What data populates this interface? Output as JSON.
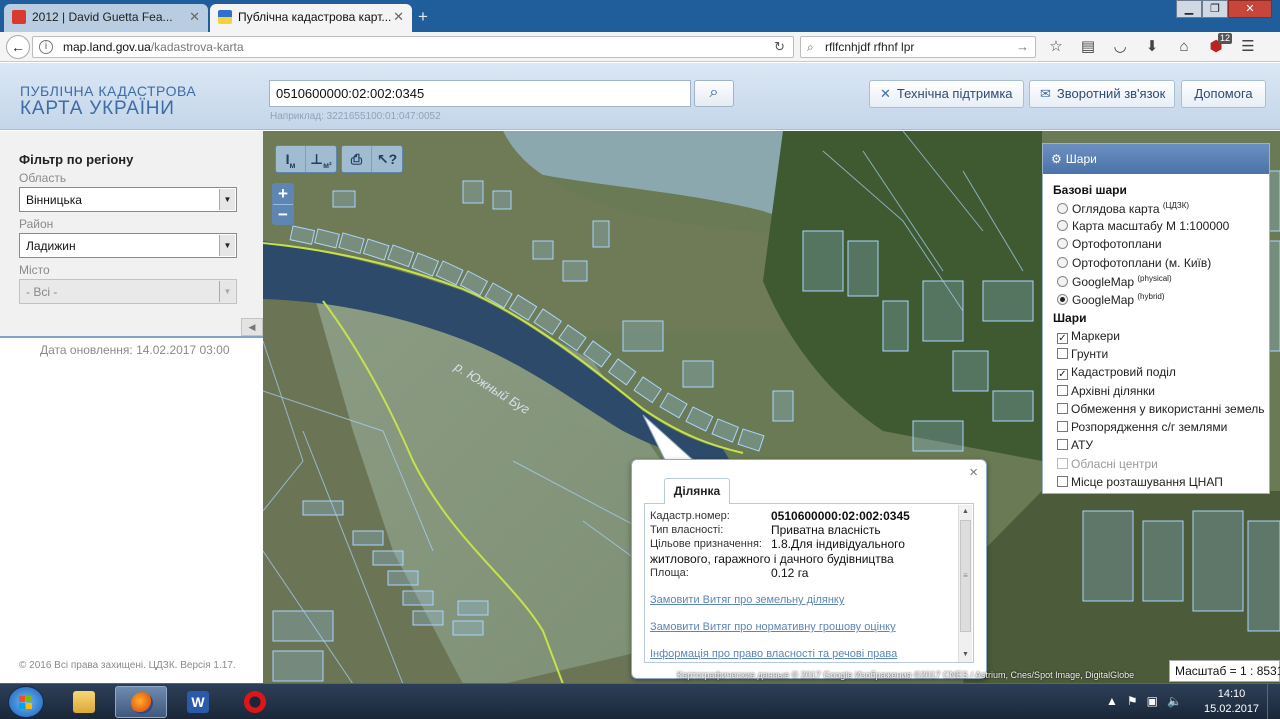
{
  "browser": {
    "tabs": [
      {
        "title": "2012 | David Guetta Fea...",
        "active": false
      },
      {
        "title": "Публічна кадастрова карт...",
        "active": true
      }
    ],
    "new_tab": "+",
    "url_host": "map.land.gov.ua",
    "url_path": "/kadastrova-karta",
    "search_value": "rflfcnhjdf rfhnf lpr",
    "addon_badge": "12"
  },
  "header": {
    "logo_line1": "ПУБЛІЧНА КАДАСТРОВА",
    "logo_line2": "КАРТА УКРАЇНИ",
    "search_value": "0510600000:02:002:0345",
    "example": "Наприклад: 3221655100:01:047:0052",
    "support": "Технічна підтримка",
    "feedback": "Зворотний зв'язок",
    "help": "Допомога"
  },
  "filter": {
    "title": "Фільтр по регіону",
    "oblast_label": "Область",
    "oblast_value": "Вінницька",
    "rayon_label": "Район",
    "rayon_value": "Ладижин",
    "city_label": "Місто",
    "city_value": "- Всі -",
    "update_date": "Дата оновлення: 14.02.2017 03:00",
    "copyright": "© 2016 Всі права захищені. ЦДЗК. Версія 1.17."
  },
  "map": {
    "tools": [
      "I м",
      "⊥ м²",
      "print",
      "?"
    ],
    "zoom_in": "+",
    "zoom_out": "−",
    "river_label": "р. Южный Буг",
    "attribution": "Картографические данные © 2017 Google Изображения ©2017 CNES / Astrium, Cnes/Spot Image, DigitalGlobe",
    "scale": "Масштаб = 1 : 8531"
  },
  "layers": {
    "title": "Шари",
    "base_title": "Базові шари",
    "base": [
      {
        "label": "Оглядова карта",
        "sup": "(ЦДЗК)",
        "selected": false
      },
      {
        "label": "Карта масштабу М 1:100000",
        "sup": "",
        "selected": false
      },
      {
        "label": "Ортофотоплани",
        "sup": "",
        "selected": false
      },
      {
        "label": "Ортофотоплани (м. Київ)",
        "sup": "",
        "selected": false
      },
      {
        "label": "GoogleMap",
        "sup": "(physical)",
        "selected": false
      },
      {
        "label": "GoogleMap",
        "sup": "(hybrid)",
        "selected": true
      }
    ],
    "overlay_title": "Шари",
    "overlays": [
      {
        "label": "Маркери",
        "checked": true
      },
      {
        "label": "Грунти",
        "checked": false
      },
      {
        "label": "Кадастровий поділ",
        "checked": true
      },
      {
        "label": "Архівні ділянки",
        "checked": false
      },
      {
        "label": "Обмеження у використанні земель",
        "checked": false
      },
      {
        "label": "Розпорядження с/г землями",
        "checked": false
      },
      {
        "label": "АТУ",
        "checked": false
      },
      {
        "label": "Обласні центри",
        "checked": false,
        "disabled": true
      },
      {
        "label": "Місце розташування ЦНАП",
        "checked": false
      }
    ]
  },
  "popup": {
    "tab": "Ділянка",
    "rows": [
      {
        "key": "Кадастр.номер:",
        "value": "0510600000:02:002:0345",
        "bold": true
      },
      {
        "key": "Тип власності:",
        "value": "Приватна власність"
      },
      {
        "key": "Цільове призначення:",
        "value": "1.8.Для індивідуального"
      },
      {
        "key": "житлового, гаражного і дачного будівництва",
        "value": ""
      },
      {
        "key": "Площа:",
        "value": "0.12 га"
      }
    ],
    "links": [
      "Замовити Витяг про земельну ділянку",
      "Замовити Витяг про нормативну грошову оцінку",
      "Інформація про право власності та речові права"
    ],
    "close": "×"
  },
  "taskbar": {
    "time": "14:10",
    "date": "15.02.2017"
  }
}
